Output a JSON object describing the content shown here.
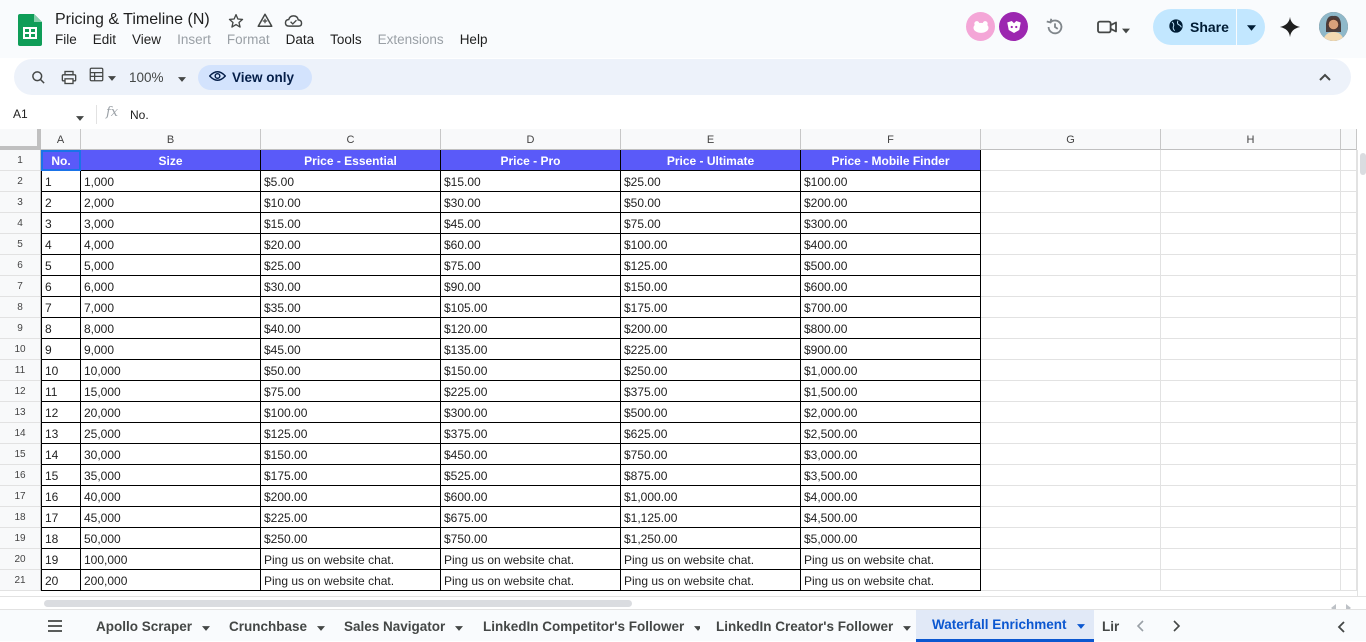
{
  "app": {
    "title": "Pricing & Timeline (N)",
    "menus": [
      {
        "label": "File",
        "enabled": true
      },
      {
        "label": "Edit",
        "enabled": true
      },
      {
        "label": "View",
        "enabled": true
      },
      {
        "label": "Insert",
        "enabled": false
      },
      {
        "label": "Format",
        "enabled": false
      },
      {
        "label": "Data",
        "enabled": true
      },
      {
        "label": "Tools",
        "enabled": true
      },
      {
        "label": "Extensions",
        "enabled": false
      },
      {
        "label": "Help",
        "enabled": true
      }
    ],
    "share_label": "Share"
  },
  "toolbar": {
    "zoom": "100%",
    "mode_label": "View only"
  },
  "formula_bar": {
    "cell_ref": "A1",
    "fx": "fx",
    "value": "No."
  },
  "grid": {
    "columns": [
      "A",
      "B",
      "C",
      "D",
      "E",
      "F",
      "G",
      "H"
    ],
    "header_row": [
      "No.",
      "Size",
      "Price - Essential",
      "Price - Pro",
      "Price - Ultimate",
      "Price - Mobile Finder"
    ],
    "rows": [
      [
        "1",
        "1,000",
        "$5.00",
        "$15.00",
        "$25.00",
        "$100.00"
      ],
      [
        "2",
        "2,000",
        "$10.00",
        "$30.00",
        "$50.00",
        "$200.00"
      ],
      [
        "3",
        "3,000",
        "$15.00",
        "$45.00",
        "$75.00",
        "$300.00"
      ],
      [
        "4",
        "4,000",
        "$20.00",
        "$60.00",
        "$100.00",
        "$400.00"
      ],
      [
        "5",
        "5,000",
        "$25.00",
        "$75.00",
        "$125.00",
        "$500.00"
      ],
      [
        "6",
        "6,000",
        "$30.00",
        "$90.00",
        "$150.00",
        "$600.00"
      ],
      [
        "7",
        "7,000",
        "$35.00",
        "$105.00",
        "$175.00",
        "$700.00"
      ],
      [
        "8",
        "8,000",
        "$40.00",
        "$120.00",
        "$200.00",
        "$800.00"
      ],
      [
        "9",
        "9,000",
        "$45.00",
        "$135.00",
        "$225.00",
        "$900.00"
      ],
      [
        "10",
        "10,000",
        "$50.00",
        "$150.00",
        "$250.00",
        "$1,000.00"
      ],
      [
        "11",
        "15,000",
        "$75.00",
        "$225.00",
        "$375.00",
        "$1,500.00"
      ],
      [
        "12",
        "20,000",
        "$100.00",
        "$300.00",
        "$500.00",
        "$2,000.00"
      ],
      [
        "13",
        "25,000",
        "$125.00",
        "$375.00",
        "$625.00",
        "$2,500.00"
      ],
      [
        "14",
        "30,000",
        "$150.00",
        "$450.00",
        "$750.00",
        "$3,000.00"
      ],
      [
        "15",
        "35,000",
        "$175.00",
        "$525.00",
        "$875.00",
        "$3,500.00"
      ],
      [
        "16",
        "40,000",
        "$200.00",
        "$600.00",
        "$1,000.00",
        "$4,000.00"
      ],
      [
        "17",
        "45,000",
        "$225.00",
        "$675.00",
        "$1,125.00",
        "$4,500.00"
      ],
      [
        "18",
        "50,000",
        "$250.00",
        "$750.00",
        "$1,250.00",
        "$5,000.00"
      ],
      [
        "19",
        "100,000",
        "Ping us on website chat.",
        "Ping us on website chat.",
        "Ping us on website chat.",
        "Ping us on website chat."
      ],
      [
        "20",
        "200,000",
        "Ping us on website chat.",
        "Ping us on website chat.",
        "Ping us on website chat.",
        "Ping us on website chat."
      ]
    ],
    "row_numbers": [
      "1",
      "2",
      "3",
      "4",
      "5",
      "6",
      "7",
      "8",
      "9",
      "10",
      "11",
      "12",
      "13",
      "14",
      "15",
      "16",
      "17",
      "18",
      "19",
      "20",
      "21"
    ],
    "header_color": "#5a5af9"
  },
  "sheets": {
    "tabs": [
      {
        "label": "Apollo Scraper",
        "active": false
      },
      {
        "label": "Crunchbase",
        "active": false
      },
      {
        "label": "Sales Navigator",
        "active": false
      },
      {
        "label": "LinkedIn Competitor's Follower",
        "active": false
      },
      {
        "label": "LinkedIn Creator's Follower",
        "active": false
      },
      {
        "label": "Waterfall Enrichment",
        "active": true
      },
      {
        "label": "Lir",
        "active": false
      }
    ]
  },
  "colors": {
    "accent": "#0b57d0",
    "share_bg": "#c2e7ff",
    "viewonly_bg": "#d3e3fd"
  }
}
